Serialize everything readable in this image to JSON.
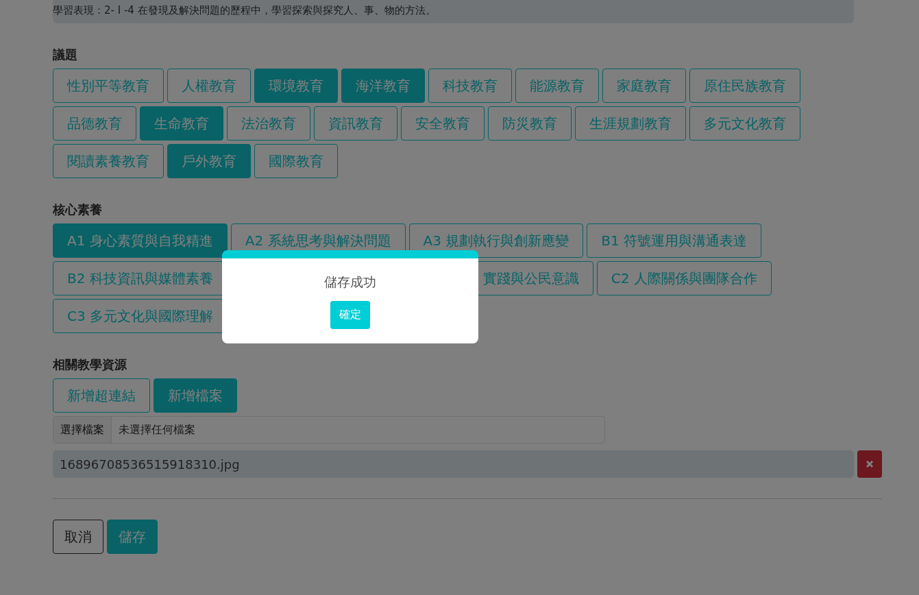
{
  "standard": "學習表現：2- Ⅰ -4 在發現及解決問題的歷程中，學習探索與探究人、事、物的方法。",
  "issues": {
    "title": "議題",
    "tags": [
      {
        "label": "性別平等教育",
        "selected": false
      },
      {
        "label": "人權教育",
        "selected": false
      },
      {
        "label": "環境教育",
        "selected": true
      },
      {
        "label": "海洋教育",
        "selected": true
      },
      {
        "label": "科技教育",
        "selected": false
      },
      {
        "label": "能源教育",
        "selected": false
      },
      {
        "label": "家庭教育",
        "selected": false
      },
      {
        "label": "原住民族教育",
        "selected": false
      },
      {
        "label": "品德教育",
        "selected": false
      },
      {
        "label": "生命教育",
        "selected": true
      },
      {
        "label": "法治教育",
        "selected": false
      },
      {
        "label": "資訊教育",
        "selected": false
      },
      {
        "label": "安全教育",
        "selected": false
      },
      {
        "label": "防災教育",
        "selected": false
      },
      {
        "label": "生涯規劃教育",
        "selected": false
      },
      {
        "label": "多元文化教育",
        "selected": false
      },
      {
        "label": "閱讀素養教育",
        "selected": false
      },
      {
        "label": "戶外教育",
        "selected": true
      },
      {
        "label": "國際教育",
        "selected": false
      }
    ]
  },
  "competencies": {
    "title": "核心素養",
    "tags": [
      {
        "label": "A1 身心素質與自我精進",
        "selected": true,
        "kind": "full"
      },
      {
        "label": "A2 系統思考與解決問題",
        "selected": false,
        "kind": "full"
      },
      {
        "label": "A3 規劃執行與創新應變",
        "selected": false,
        "kind": "full"
      },
      {
        "label": "B1 符號運用與溝通表達",
        "selected": false,
        "kind": "full"
      },
      {
        "label": "B2 科技資訊與媒體素養",
        "selected": false,
        "kind": "full"
      },
      {
        "label": "實踐與公民意識",
        "selected": false,
        "kind": "covered"
      },
      {
        "label": "C2 人際關係與團隊合作",
        "selected": false,
        "kind": "full"
      },
      {
        "label": "C3 多元文化與國際理解",
        "selected": false,
        "kind": "full"
      }
    ]
  },
  "resources": {
    "title": "相關教學資源",
    "buttons": [
      {
        "label": "新增超連結",
        "selected": false
      },
      {
        "label": "新增檔案",
        "selected": true
      }
    ],
    "file_input": {
      "button": "選擇檔案",
      "value": "未選擇任何檔案"
    },
    "attachments": [
      {
        "name": "16896708536515918310.jpg"
      }
    ]
  },
  "actions": {
    "cancel": "取消",
    "save": "儲存"
  },
  "dialog": {
    "message": "儲存成功",
    "confirm": "確定"
  }
}
